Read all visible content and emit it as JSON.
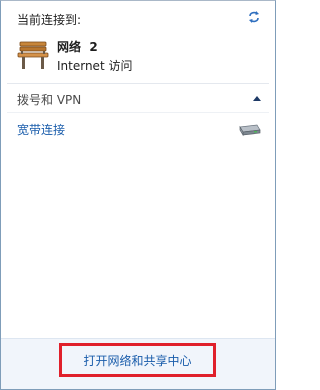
{
  "header": {
    "title": "当前连接到:",
    "refresh_icon": "refresh-icon"
  },
  "current_network": {
    "icon": "bench-icon",
    "name": "网络  2",
    "status": "Internet 访问"
  },
  "dialup_section": {
    "title": "拨号和 VPN",
    "collapse_icon": "chevron-up-icon",
    "items": [
      {
        "label": "宽带连接",
        "icon": "modem-icon"
      }
    ]
  },
  "footer": {
    "open_center_label": "打开网络和共享中心",
    "highlight_color": "#e0202b"
  },
  "colors": {
    "link": "#1a5dab",
    "footer_bg": "#f1f5fb"
  }
}
